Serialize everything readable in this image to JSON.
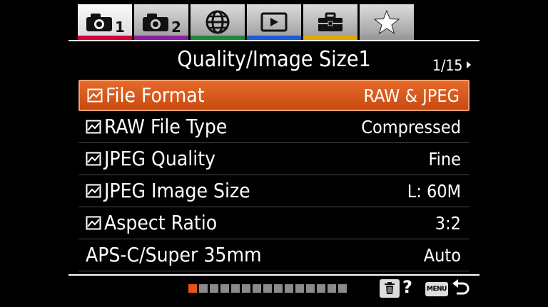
{
  "tabs": [
    {
      "name": "camera-settings-1",
      "icon": "camera-icon",
      "sub": "1",
      "strip": "#d2003a",
      "active": true
    },
    {
      "name": "camera-settings-2",
      "icon": "camera-icon",
      "sub": "2",
      "strip": "#8a1fa0",
      "active": false
    },
    {
      "name": "network",
      "icon": "globe-icon",
      "sub": "",
      "strip": "#1b8a3a",
      "active": false
    },
    {
      "name": "playback",
      "icon": "playback-icon",
      "sub": "",
      "strip": "#1a5bd6",
      "active": false
    },
    {
      "name": "setup",
      "icon": "toolbox-icon",
      "sub": "",
      "strip": "#e0a800",
      "active": false
    },
    {
      "name": "my-menu",
      "icon": "star-icon",
      "sub": "",
      "strip": "#9a9a9a",
      "active": false
    }
  ],
  "header": {
    "title": "Quality/Image Size1",
    "page": "1/15"
  },
  "menu": [
    {
      "label": "File Format",
      "value": "RAW & JPEG",
      "still_icon": true,
      "selected": true
    },
    {
      "label": "RAW File Type",
      "value": "Compressed",
      "still_icon": true,
      "selected": false
    },
    {
      "label": "JPEG Quality",
      "value": "Fine",
      "still_icon": true,
      "selected": false
    },
    {
      "label": "JPEG Image Size",
      "value": "L: 60M",
      "still_icon": true,
      "selected": false
    },
    {
      "label": "Aspect Ratio",
      "value": "3:2",
      "still_icon": true,
      "selected": false
    },
    {
      "label": "APS-C/Super 35mm",
      "value": "Auto",
      "still_icon": false,
      "selected": false
    }
  ],
  "footer": {
    "page_count": 15,
    "current_page": 1,
    "help_label": "?",
    "menu_key_label": "MENU",
    "trash_icon": "trash-icon",
    "back_icon": "return-arrow-icon"
  },
  "colors": {
    "selected_row": "#d9581c",
    "active_dot": "#e8531a",
    "inactive_dot": "#8a8a8a"
  }
}
